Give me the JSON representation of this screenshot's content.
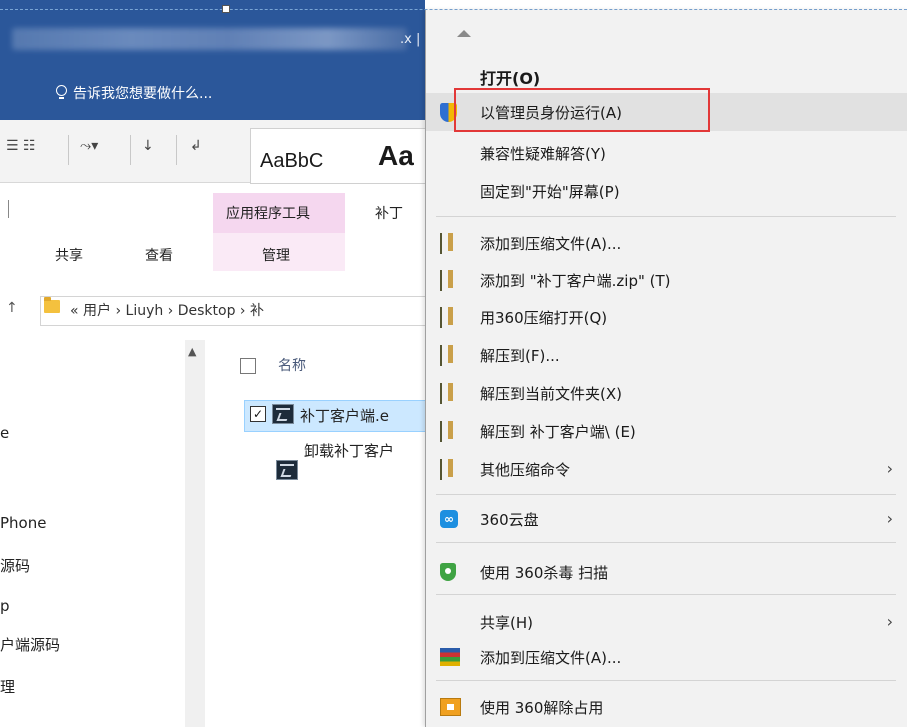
{
  "word": {
    "title_ext": ".x |",
    "tell_me": "告诉我您想要做什么...",
    "style_preview_1": "AaBbC",
    "style_preview_2": "Aa"
  },
  "explorer": {
    "context_tab": "应用程序工具",
    "context_tab_sub": "管理",
    "tab_right": "补丁",
    "tab_share": "共享",
    "tab_view": "查看",
    "breadcrumb": "« 用户 › Liuyh › Desktop › 补",
    "nav_items": [
      "e",
      "Phone",
      "源码",
      "p",
      "户端源码",
      "理"
    ],
    "column_name": "名称",
    "files": [
      {
        "name": "补丁客户端.e",
        "selected": true
      },
      {
        "name": "卸载补丁客户",
        "selected": false
      }
    ]
  },
  "context_menu": {
    "items": [
      {
        "label": "打开(O)",
        "bold": true,
        "icon": ""
      },
      {
        "label": "以管理员身份运行(A)",
        "icon": "uac-shield-icon",
        "highlighted": true
      },
      {
        "label": "兼容性疑难解答(Y)",
        "icon": ""
      },
      {
        "label": "固定到\"开始\"屏幕(P)",
        "icon": ""
      },
      {
        "label": "添加到压缩文件(A)...",
        "icon": "rar-icon"
      },
      {
        "label": "添加到 \"补丁客户端.zip\" (T)",
        "icon": "rar-icon"
      },
      {
        "label": "用360压缩打开(Q)",
        "icon": "rar-icon"
      },
      {
        "label": "解压到(F)...",
        "icon": "rar-icon"
      },
      {
        "label": "解压到当前文件夹(X)",
        "icon": "rar-icon"
      },
      {
        "label": "解压到 补丁客户端\\ (E)",
        "icon": "rar-icon"
      },
      {
        "label": "其他压缩命令",
        "icon": "rar-icon",
        "submenu": true
      },
      {
        "label": "360云盘",
        "icon": "cloud-icon",
        "submenu": true
      },
      {
        "label": "使用 360杀毒 扫描",
        "icon": "antivirus-icon"
      },
      {
        "label": "共享(H)",
        "icon": "",
        "submenu": true
      },
      {
        "label": "添加到压缩文件(A)...",
        "icon": "winrar-icon"
      },
      {
        "label": "使用 360解除占用",
        "icon": "unlock-icon"
      }
    ],
    "chevron": "›",
    "cloud_glyph": "∞"
  },
  "colors": {
    "word_blue": "#2b579a",
    "highlight_border": "#e23838",
    "menu_bg": "#f2f2f2"
  }
}
